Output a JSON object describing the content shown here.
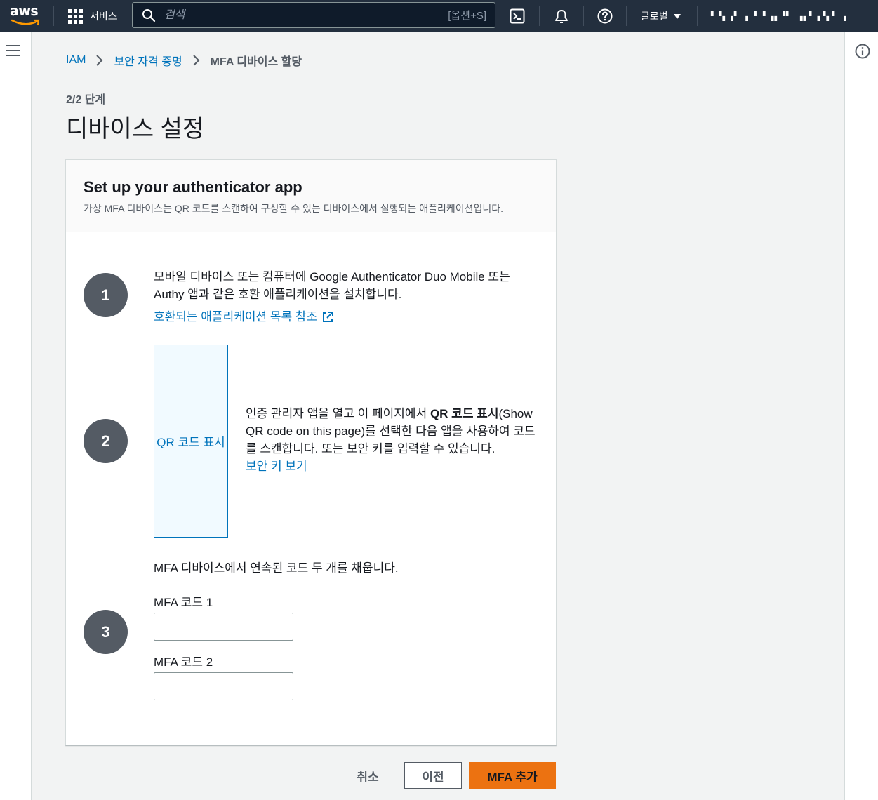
{
  "nav": {
    "logo_text": "aws",
    "services_label": "서비스",
    "search_placeholder": "검색",
    "search_shortcut": "[옵션+S]",
    "region_label": "글로벌",
    "account_label": "▘▝▖▗▘ ▖▝ ▘▗▖▝▘ ▗▖▘▗▝▖▘ ▖"
  },
  "breadcrumb": {
    "items": [
      "IAM",
      "보안 자격 증명"
    ],
    "current": "MFA 디바이스 할당"
  },
  "page": {
    "step_label": "2/2 단계",
    "title": "디바이스 설정"
  },
  "card": {
    "title": "Set up your authenticator app",
    "description": "가상 MFA 디바이스는 QR 코드를 스캔하여 구성할 수 있는 디바이스에서 실행되는 애플리케이션입니다.",
    "steps": [
      {
        "number": "1",
        "line1": "모바일 디바이스 또는 컴퓨터에 Google Authenticator Duo Mobile 또는",
        "line2": "Authy 앱과 같은 호환 애플리케이션을 설치합니다.",
        "link": "호환되는 애플리케이션 목록 참조"
      },
      {
        "number": "2",
        "qr_button": "QR 코드 표시",
        "text_pre": "인증 관리자 앱을 열고 이 페이지에서 ",
        "text_bold": "QR 코드 표시",
        "text_mid": "(Show",
        "line2": "QR code on this page)를 선택한 다음 앱을 사용하여 코드",
        "line3": "를 스캔합니다. 또는 보안 키를 입력할 수 있습니다.",
        "link": "보안 키 보기"
      },
      {
        "number": "3",
        "intro": "MFA 디바이스에서 연속된 코드 두 개를 채웁니다.",
        "code1_label": "MFA 코드 1",
        "code1_value": "",
        "code2_label": "MFA 코드 2",
        "code2_value": ""
      }
    ]
  },
  "footer": {
    "cancel": "취소",
    "previous": "이전",
    "submit": "MFA 추가"
  },
  "colors": {
    "nav_bg": "#232f3e",
    "link": "#0073bb",
    "primary": "#ec7211",
    "circle": "#545b64"
  }
}
